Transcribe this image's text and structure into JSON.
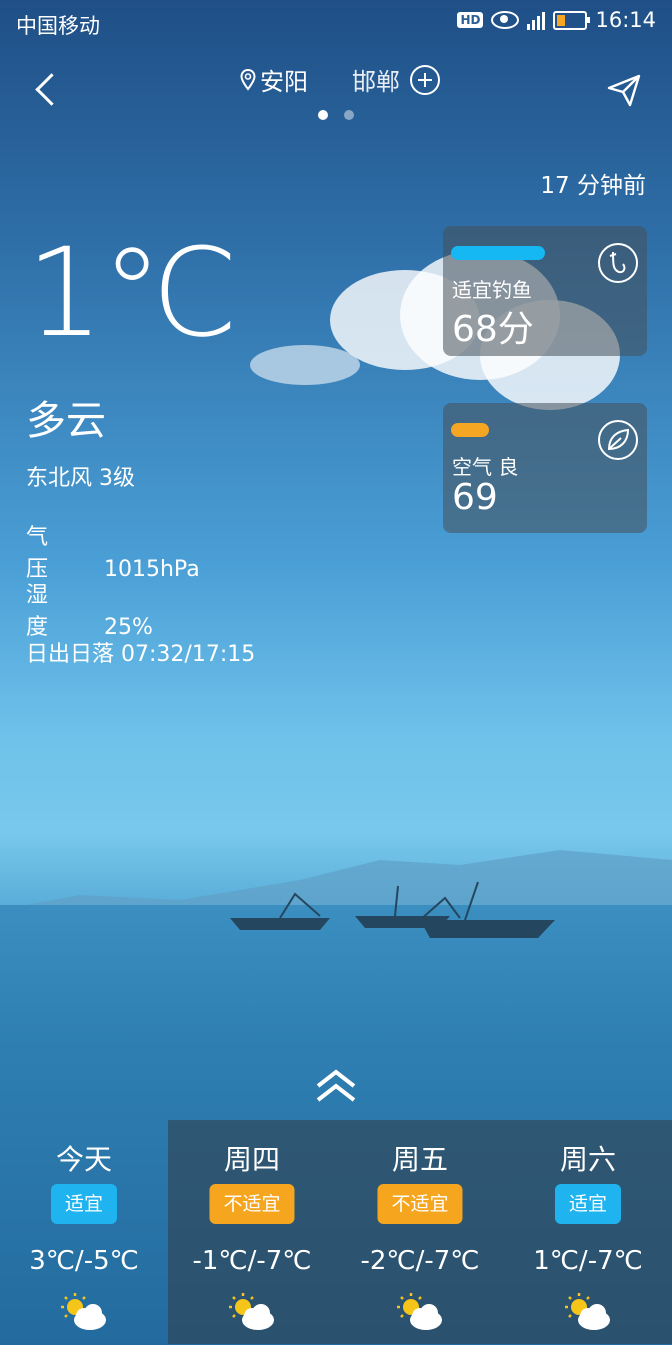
{
  "status": {
    "carrier": "中国移动",
    "hd": "HD",
    "time": "16:14"
  },
  "header": {
    "active_city": "安阳",
    "other_city": "邯郸"
  },
  "updated": "17 分钟前",
  "current": {
    "temp": "1℃",
    "condition": "多云",
    "wind": "东北风 3级",
    "pressure_label": "气　　压",
    "pressure_value": "1015hPa",
    "humidity_label": "湿　　度",
    "humidity_value": "25%",
    "sun_label": "日出日落",
    "sun_value": "07:32/17:15"
  },
  "cards": {
    "fishing": {
      "title": "适宜钓鱼",
      "value": "68分",
      "bar_color": "#16b8f3"
    },
    "air": {
      "title": "空气 良",
      "value": "69",
      "bar_color": "#f5a623"
    }
  },
  "forecast": [
    {
      "day": "今天",
      "tag": "适宜",
      "range": "3℃/-5℃",
      "icon": "partly-cloudy-icon"
    },
    {
      "day": "周四",
      "tag": "不适宜",
      "range": "-1℃/-7℃",
      "icon": "partly-cloudy-icon"
    },
    {
      "day": "周五",
      "tag": "不适宜",
      "range": "-2℃/-7℃",
      "icon": "partly-cloudy-icon"
    },
    {
      "day": "周六",
      "tag": "适宜",
      "range": "1℃/-7℃",
      "icon": "partly-cloudy-icon"
    }
  ],
  "colors": {
    "good": "#1fb3f0",
    "bad": "#f6a51f"
  }
}
